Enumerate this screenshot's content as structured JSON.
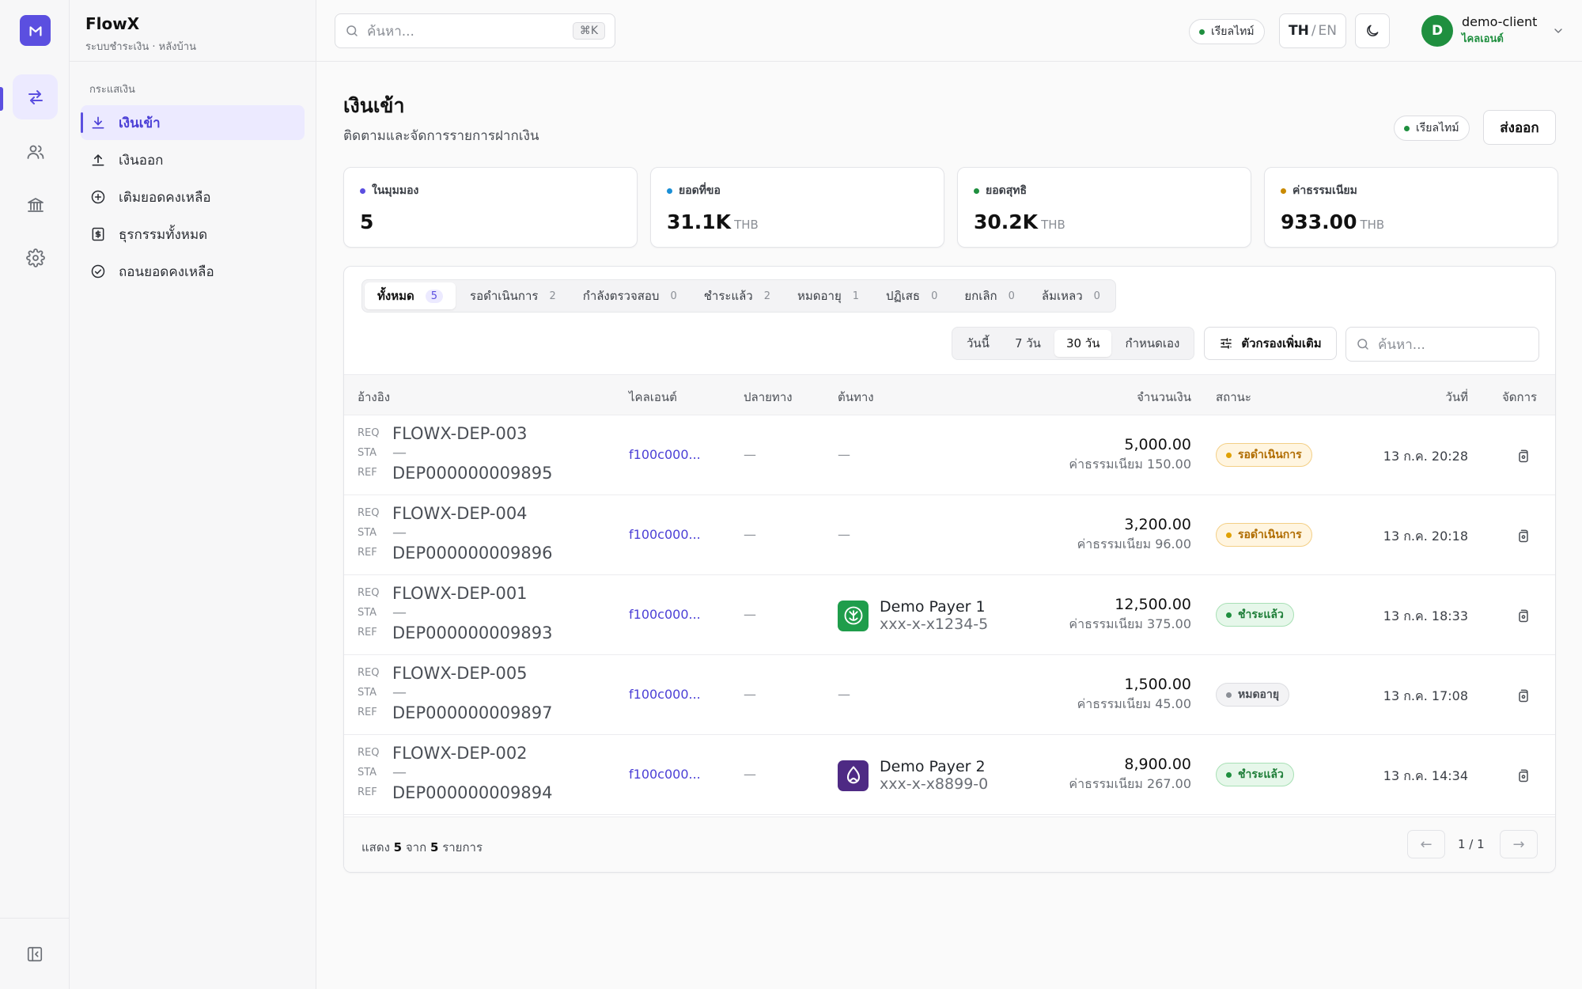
{
  "colors": {
    "accent": "#5b4fe0",
    "success": "#1f8f3f",
    "warning": "#e0a100",
    "info": "#1a8fd6"
  },
  "brand": {
    "name": "FlowX",
    "subtitle": "ระบบชำระเงิน · หลังบ้าน"
  },
  "rail": {
    "items": [
      "transfer-icon",
      "users-icon",
      "bank-icon",
      "settings-icon"
    ],
    "bottom": "collapse-sidebar-icon"
  },
  "sidenav": {
    "section": "กระแสเงิน",
    "items": [
      {
        "label": "เงินเข้า",
        "icon": "download-icon",
        "active": true
      },
      {
        "label": "เงินออก",
        "icon": "upload-icon"
      },
      {
        "label": "เติมยอดคงเหลือ",
        "icon": "plus-circle-icon"
      },
      {
        "label": "ธุรกรรมทั้งหมด",
        "icon": "receipt-icon"
      },
      {
        "label": "ถอนยอดคงเหลือ",
        "icon": "check-circle-icon"
      }
    ]
  },
  "topbar": {
    "search_placeholder": "ค้นหา...",
    "shortcut": "⌘K",
    "live_label": "เรียลไทม์",
    "lang_active": "TH",
    "lang_sep": "/",
    "lang_other": "EN",
    "theme_icon": "moon-icon",
    "user": {
      "initial": "D",
      "name": "demo-client",
      "role": "ไคลเอนต์"
    }
  },
  "page": {
    "title": "เงินเข้า",
    "subtitle": "ติดตามและจัดการรายการฝากเงิน",
    "live_label": "เรียลไทม์",
    "export_label": "ส่งออก"
  },
  "stats": [
    {
      "label": "ในมุมมอง",
      "value": "5",
      "unit": "",
      "color": "#5b4fe0"
    },
    {
      "label": "ยอดที่ขอ",
      "value": "31.1K",
      "unit": "THB",
      "color": "#1a8fd6"
    },
    {
      "label": "ยอดสุทธิ",
      "value": "30.2K",
      "unit": "THB",
      "color": "#1f8f3f"
    },
    {
      "label": "ค่าธรรมเนียม",
      "value": "933.00",
      "unit": "THB",
      "color": "#c98a00"
    }
  ],
  "tabs": [
    {
      "label": "ทั้งหมด",
      "count": "5",
      "active": true
    },
    {
      "label": "รอดำเนินการ",
      "count": "2"
    },
    {
      "label": "กำลังตรวจสอบ",
      "count": "0"
    },
    {
      "label": "ชำระแล้ว",
      "count": "2"
    },
    {
      "label": "หมดอายุ",
      "count": "1"
    },
    {
      "label": "ปฏิเสธ",
      "count": "0"
    },
    {
      "label": "ยกเลิก",
      "count": "0"
    },
    {
      "label": "ล้มเหลว",
      "count": "0"
    }
  ],
  "ranges": [
    {
      "label": "วันนี้"
    },
    {
      "label": "7 วัน"
    },
    {
      "label": "30 วัน",
      "active": true
    },
    {
      "label": "กำหนดเอง"
    }
  ],
  "filter_label": "ตัวกรองเพิ่มเติม",
  "table_search_placeholder": "ค้นหา...",
  "table": {
    "headers": {
      "ref": "อ้างอิง",
      "client": "ไคลเอนต์",
      "dest": "ปลายทาง",
      "src": "ต้นทาง",
      "amount": "จำนวนเงิน",
      "status": "สถานะ",
      "date": "วันที่",
      "action": "จัดการ"
    },
    "tag_req": "REQ",
    "tag_sta": "STA",
    "tag_ref": "REF",
    "rows": [
      {
        "req": "FLOWX-DEP-003",
        "sta": "—",
        "ref": "DEP000000009895",
        "client": "f100c000...",
        "dest": "—",
        "src": "—",
        "amount": "5,000.00",
        "fee": "ค่าธรรมเนียม 150.00",
        "status": "รอดำเนินการ",
        "status_kind": "pending",
        "date": "13 ก.ค. 20:28"
      },
      {
        "req": "FLOWX-DEP-004",
        "sta": "—",
        "ref": "DEP000000009896",
        "client": "f100c000...",
        "dest": "—",
        "src": "—",
        "amount": "3,200.00",
        "fee": "ค่าธรรมเนียม 96.00",
        "status": "รอดำเนินการ",
        "status_kind": "pending",
        "date": "13 ก.ค. 20:18"
      },
      {
        "req": "FLOWX-DEP-001",
        "sta": "—",
        "ref": "DEP000000009893",
        "client": "f100c000...",
        "dest": "—",
        "src_name": "Demo Payer 1",
        "src_acc": "xxx-x-x1234-5",
        "src_logo": "kbank-logo-icon",
        "src_color": "#1f9d4b",
        "amount": "12,500.00",
        "fee": "ค่าธรรมเนียม 375.00",
        "status": "ชำระแล้ว",
        "status_kind": "paid",
        "date": "13 ก.ค. 18:33"
      },
      {
        "req": "FLOWX-DEP-005",
        "sta": "—",
        "ref": "DEP000000009897",
        "client": "f100c000...",
        "dest": "—",
        "src": "—",
        "amount": "1,500.00",
        "fee": "ค่าธรรมเนียม 45.00",
        "status": "หมดอายุ",
        "status_kind": "expired",
        "date": "13 ก.ค. 17:08"
      },
      {
        "req": "FLOWX-DEP-002",
        "sta": "—",
        "ref": "DEP000000009894",
        "client": "f100c000...",
        "dest": "—",
        "src_name": "Demo Payer 2",
        "src_acc": "xxx-x-x8899-0",
        "src_logo": "scb-logo-icon",
        "src_color": "#4e2a84",
        "amount": "8,900.00",
        "fee": "ค่าธรรมเนียม 267.00",
        "status": "ชำระแล้ว",
        "status_kind": "paid",
        "date": "13 ก.ค. 14:34"
      }
    ]
  },
  "footer": {
    "prefix": "แสดง",
    "shown": "5",
    "mid": "จาก",
    "total": "5",
    "suffix": "รายการ",
    "page": "1 / 1",
    "prev": "←",
    "next": "→"
  }
}
